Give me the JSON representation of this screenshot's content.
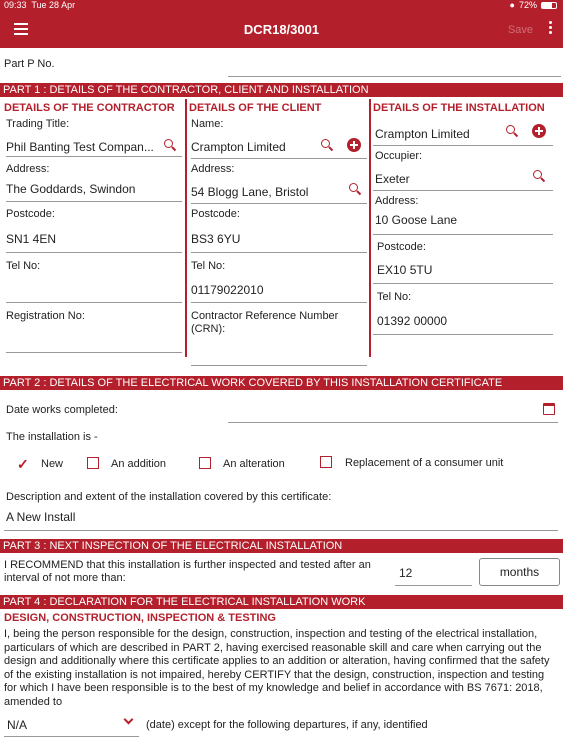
{
  "status_bar": {
    "time": "09:33",
    "date": "Tue 28 Apr",
    "battery": "72%"
  },
  "app_bar": {
    "title": "DCR18/3001",
    "faded_action": "Save"
  },
  "part_p": {
    "label": "Part P No.",
    "value": ""
  },
  "part1": {
    "heading": "PART 1 : DETAILS OF THE CONTRACTOR, CLIENT AND INSTALLATION",
    "contractor": {
      "heading": "DETAILS OF THE CONTRACTOR",
      "trading_title_label": "Trading Title:",
      "trading_title_value": "Phil Banting Test Compan...",
      "address_label": "Address:",
      "address_value": "The Goddards, Swindon",
      "postcode_label": "Postcode:",
      "postcode_value": "SN1 4EN",
      "tel_label": "Tel No:",
      "tel_value": "",
      "registration_label": "Registration No:",
      "registration_value": ""
    },
    "client": {
      "heading": "DETAILS OF THE CLIENT",
      "name_label": "Name:",
      "name_value": "Crampton Limited",
      "address_label": "Address:",
      "address_value": "54 Blogg Lane, Bristol",
      "postcode_label": "Postcode:",
      "postcode_value": "BS3 6YU",
      "tel_label": "Tel No:",
      "tel_value": "01179022010",
      "crn_label": "Contractor Reference Number (CRN):",
      "crn_value": ""
    },
    "installation": {
      "heading": "DETAILS OF THE INSTALLATION",
      "name_value": "Crampton Limited",
      "occupier_label": "Occupier:",
      "occupier_value": "Exeter",
      "address_label": "Address:",
      "address_value": "10 Goose Lane",
      "postcode_label": "Postcode:",
      "postcode_value": "EX10 5TU",
      "tel_label": "Tel No:",
      "tel_value": "01392 00000"
    }
  },
  "part2": {
    "heading": "PART 2 : DETAILS OF THE ELECTRICAL WORK COVERED BY THIS INSTALLATION CERTIFICATE",
    "date_label": "Date works completed:",
    "date_value": "",
    "installation_is_label": "The installation is -",
    "options": [
      {
        "label": "New",
        "checked": true
      },
      {
        "label": "An addition",
        "checked": false
      },
      {
        "label": "An alteration",
        "checked": false
      },
      {
        "label": "Replacement of a consumer unit",
        "checked": false
      }
    ],
    "description_label": "Description and extent of the installation covered by this certificate:",
    "description_value": "A New Install"
  },
  "part3": {
    "heading": "PART 3 : NEXT INSPECTION OF THE ELECTRICAL INSTALLATION",
    "recommend_text": "I RECOMMEND that this installation is further inspected and tested after an interval of not more than:",
    "interval_value": "12",
    "unit_button": "months"
  },
  "part4": {
    "heading": "PART 4 : DECLARATION FOR THE ELECTRICAL INSTALLATION WORK",
    "subheading": "DESIGN, CONSTRUCTION, INSPECTION & TESTING",
    "declaration": "I, being the person responsible for the design, construction, inspection and testing of the electrical installation, particulars of which are described in PART 2, having exercised reasonable skill and care when carrying out the design and additionally where this certificate applies to an addition or alteration, having confirmed that the safety of the existing installation is not impaired, hereby CERTIFY that the design, construction, inspection and testing for which I have been responsible is to the best of my knowledge and belief in accordance with BS 7671: 2018, amended to",
    "amended_select": "N/A",
    "departures_text": "(date) except for the following departures, if any, identified"
  },
  "colors": {
    "accent": "#b3202c"
  }
}
